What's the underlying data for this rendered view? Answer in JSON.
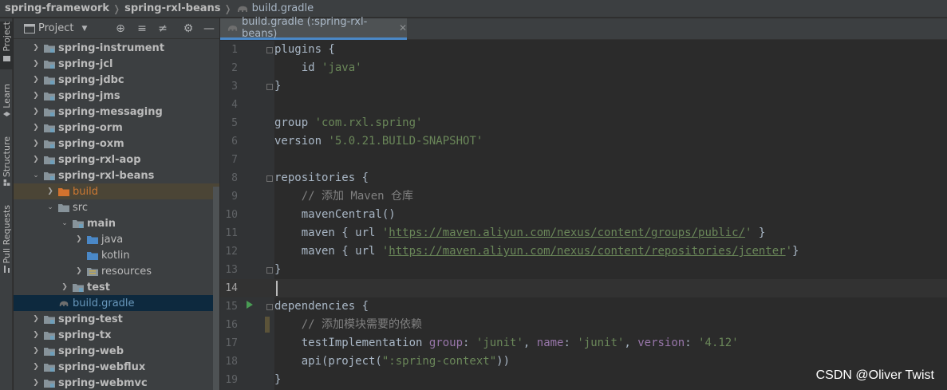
{
  "breadcrumb": {
    "items": [
      "spring-framework",
      "spring-rxl-beans",
      "build.gradle"
    ],
    "separator": "❭"
  },
  "tool_stripe": {
    "tabs": [
      "Project",
      "Learn",
      "Structure",
      "Pull Requests"
    ]
  },
  "project_panel": {
    "title": "Project",
    "tree": [
      {
        "label": "spring-instrument",
        "depth": 1,
        "arrow": "collapsed",
        "icon": "module-folder",
        "bold": true
      },
      {
        "label": "spring-jcl",
        "depth": 1,
        "arrow": "collapsed",
        "icon": "module-folder",
        "bold": true
      },
      {
        "label": "spring-jdbc",
        "depth": 1,
        "arrow": "collapsed",
        "icon": "module-folder",
        "bold": true
      },
      {
        "label": "spring-jms",
        "depth": 1,
        "arrow": "collapsed",
        "icon": "module-folder",
        "bold": true
      },
      {
        "label": "spring-messaging",
        "depth": 1,
        "arrow": "collapsed",
        "icon": "module-folder",
        "bold": true
      },
      {
        "label": "spring-orm",
        "depth": 1,
        "arrow": "collapsed",
        "icon": "module-folder",
        "bold": true
      },
      {
        "label": "spring-oxm",
        "depth": 1,
        "arrow": "collapsed",
        "icon": "module-folder",
        "bold": true
      },
      {
        "label": "spring-rxl-aop",
        "depth": 1,
        "arrow": "collapsed",
        "icon": "module-folder",
        "bold": true
      },
      {
        "label": "spring-rxl-beans",
        "depth": 1,
        "arrow": "expanded",
        "icon": "module-folder",
        "bold": true
      },
      {
        "label": "build",
        "depth": 2,
        "arrow": "collapsed",
        "icon": "excluded-folder",
        "bold": false
      },
      {
        "label": "src",
        "depth": 2,
        "arrow": "expanded",
        "icon": "plain-folder",
        "bold": false
      },
      {
        "label": "main",
        "depth": 3,
        "arrow": "expanded",
        "icon": "module-folder",
        "bold": true
      },
      {
        "label": "java",
        "depth": 4,
        "arrow": "collapsed",
        "icon": "source-folder",
        "bold": false
      },
      {
        "label": "kotlin",
        "depth": 4,
        "arrow": "none",
        "icon": "source-folder",
        "bold": false
      },
      {
        "label": "resources",
        "depth": 4,
        "arrow": "collapsed",
        "icon": "resource-folder",
        "bold": false
      },
      {
        "label": "test",
        "depth": 3,
        "arrow": "collapsed",
        "icon": "module-folder",
        "bold": true
      },
      {
        "label": "build.gradle",
        "depth": 2,
        "arrow": "none",
        "icon": "gradle-file",
        "bold": false
      },
      {
        "label": "spring-test",
        "depth": 1,
        "arrow": "collapsed",
        "icon": "module-folder",
        "bold": true
      },
      {
        "label": "spring-tx",
        "depth": 1,
        "arrow": "collapsed",
        "icon": "module-folder",
        "bold": true
      },
      {
        "label": "spring-web",
        "depth": 1,
        "arrow": "collapsed",
        "icon": "module-folder",
        "bold": true
      },
      {
        "label": "spring-webflux",
        "depth": 1,
        "arrow": "collapsed",
        "icon": "module-folder",
        "bold": true
      },
      {
        "label": "spring-webmvc",
        "depth": 1,
        "arrow": "collapsed",
        "icon": "module-folder",
        "bold": true
      }
    ]
  },
  "editor": {
    "tab_label": "build.gradle (:spring-rxl-beans)",
    "current_line": 14,
    "lines": [
      {
        "n": "1",
        "segs": [
          [
            "plain",
            "plugins {"
          ]
        ]
      },
      {
        "n": "2",
        "segs": [
          [
            "plain",
            "    id "
          ],
          [
            "str",
            "'java'"
          ]
        ]
      },
      {
        "n": "3",
        "segs": [
          [
            "plain",
            "}"
          ]
        ]
      },
      {
        "n": "4",
        "segs": []
      },
      {
        "n": "5",
        "segs": [
          [
            "plain",
            "group "
          ],
          [
            "str",
            "'com.rxl.spring'"
          ]
        ]
      },
      {
        "n": "6",
        "segs": [
          [
            "plain",
            "version "
          ],
          [
            "str",
            "'5.0.21.BUILD-SNAPSHOT'"
          ]
        ]
      },
      {
        "n": "7",
        "segs": []
      },
      {
        "n": "8",
        "segs": [
          [
            "plain",
            "repositories {"
          ]
        ]
      },
      {
        "n": "9",
        "segs": [
          [
            "cmt",
            "    // 添加 Maven 仓库"
          ]
        ]
      },
      {
        "n": "10",
        "segs": [
          [
            "plain",
            "    mavenCentral()"
          ]
        ]
      },
      {
        "n": "11",
        "segs": [
          [
            "plain",
            "    maven { url "
          ],
          [
            "str",
            "'"
          ],
          [
            "url",
            "https://maven.aliyun.com/nexus/content/groups/public/"
          ],
          [
            "str",
            "'"
          ],
          [
            "plain",
            " }"
          ]
        ]
      },
      {
        "n": "12",
        "segs": [
          [
            "plain",
            "    maven { url "
          ],
          [
            "str",
            "'"
          ],
          [
            "url",
            "https://maven.aliyun.com/nexus/content/repositories/jcenter"
          ],
          [
            "str",
            "'"
          ],
          [
            "plain",
            "}"
          ]
        ]
      },
      {
        "n": "13",
        "segs": [
          [
            "plain",
            "}"
          ]
        ]
      },
      {
        "n": "14",
        "segs": []
      },
      {
        "n": "15",
        "segs": [
          [
            "plain",
            "dependencies {"
          ]
        ]
      },
      {
        "n": "16",
        "segs": [
          [
            "cmt",
            "    // 添加模块需要的依赖"
          ]
        ]
      },
      {
        "n": "17",
        "segs": [
          [
            "plain",
            "    testImplementation "
          ],
          [
            "param",
            "group"
          ],
          [
            "plain",
            ": "
          ],
          [
            "str",
            "'junit'"
          ],
          [
            "plain",
            ", "
          ],
          [
            "param",
            "name"
          ],
          [
            "plain",
            ": "
          ],
          [
            "str",
            "'junit'"
          ],
          [
            "plain",
            ", "
          ],
          [
            "param",
            "version"
          ],
          [
            "plain",
            ": "
          ],
          [
            "str",
            "'4.12'"
          ]
        ]
      },
      {
        "n": "18",
        "segs": [
          [
            "plain",
            "    api(project("
          ],
          [
            "str",
            "\":spring-context\""
          ],
          [
            "plain",
            "))"
          ]
        ]
      },
      {
        "n": "19",
        "segs": [
          [
            "plain",
            "}"
          ]
        ]
      }
    ]
  },
  "watermark": "CSDN @Oliver  Twist",
  "colors": {
    "background": "#2b2b2b",
    "panel": "#3c3f41",
    "string": "#6a8759",
    "comment": "#808080",
    "param": "#9876aa",
    "accent": "#4a88c7"
  }
}
